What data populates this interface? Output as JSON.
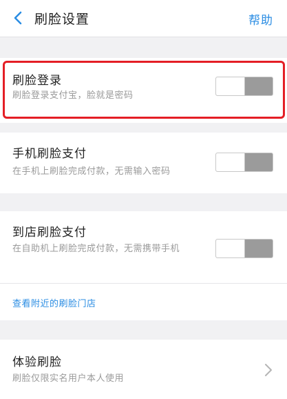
{
  "nav": {
    "back_icon": "chevron-left-icon",
    "title": "刷脸设置",
    "help": "帮助"
  },
  "settings": [
    {
      "title": "刷脸登录",
      "subtitle": "刷脸登录支付宝，脸就是密码",
      "enabled": false,
      "highlighted": true
    },
    {
      "title": "手机刷脸支付",
      "subtitle": "在手机上刷脸完成付款，无需输入密码",
      "enabled": false
    },
    {
      "title": "到店刷脸支付",
      "subtitle": "在自助机上刷脸完成付款，无需携带手机",
      "enabled": false,
      "link": "查看附近的刷脸门店"
    },
    {
      "title": "体验刷脸",
      "subtitle": "刷脸仅限实名用户本人使用",
      "chevron_icon": "chevron-right-icon"
    }
  ],
  "colors": {
    "accent": "#2b8de3",
    "highlight": "#e41e25",
    "toggle_off_track": "#9b9b9b"
  }
}
